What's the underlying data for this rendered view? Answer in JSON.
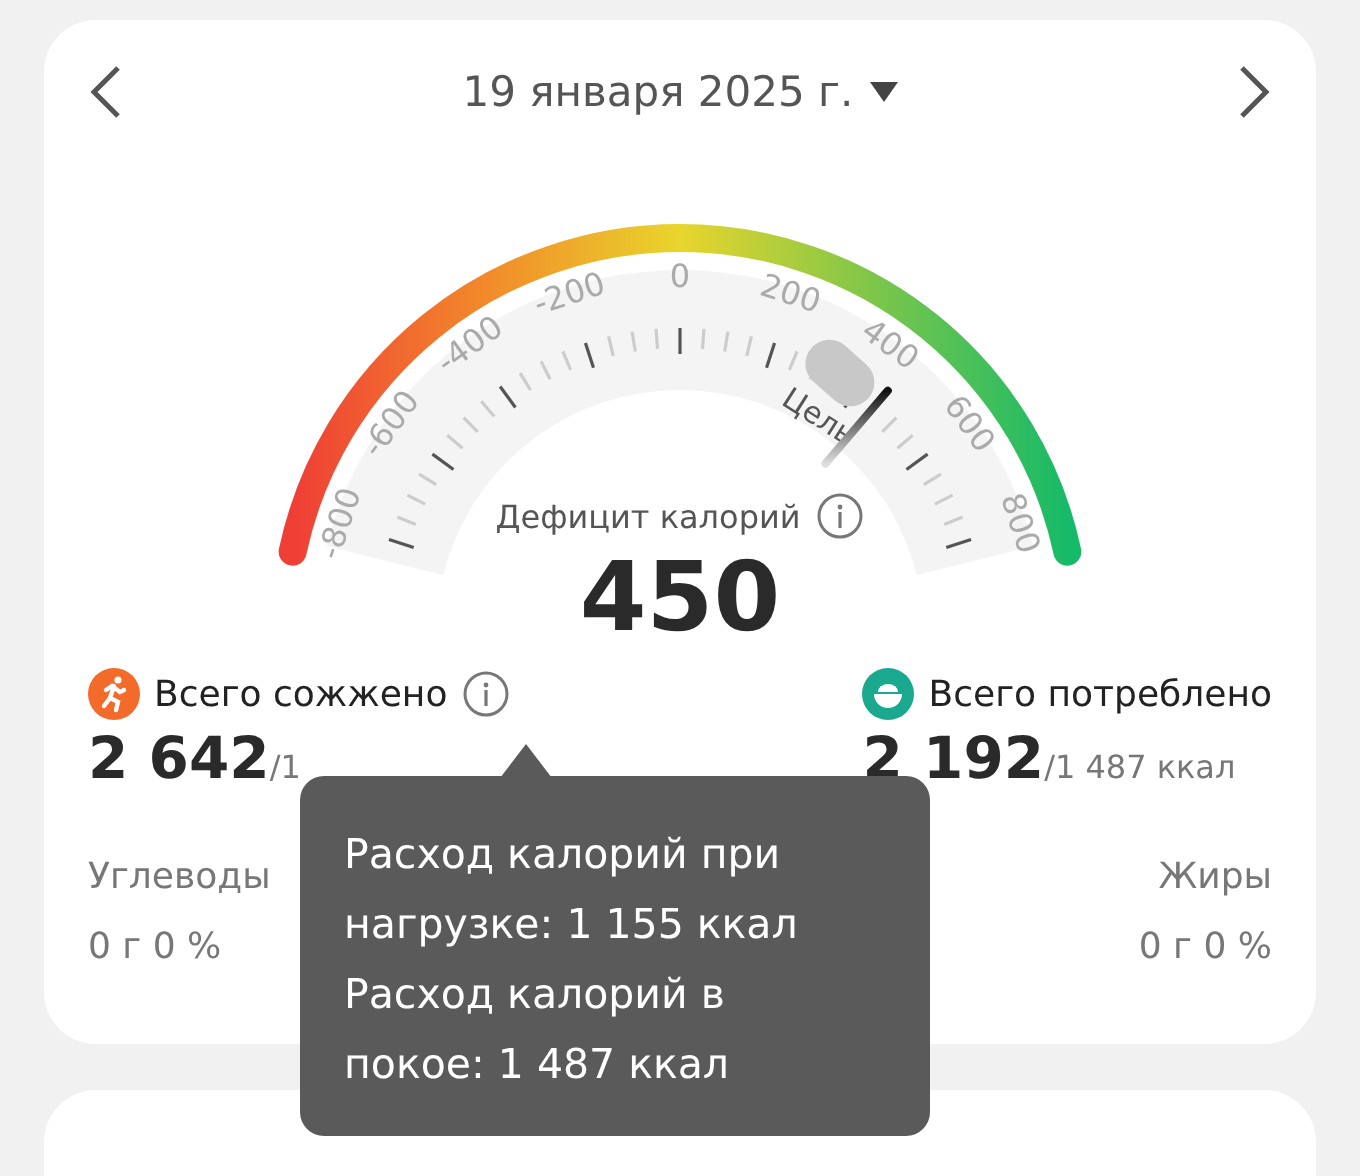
{
  "header": {
    "date": "19 января 2025 г."
  },
  "gauge": {
    "ticks": [
      "-800",
      "-600",
      "-400",
      "-200",
      "0",
      "200",
      "400",
      "600",
      "800"
    ],
    "goal_label": "Цель",
    "title": "Дефицит калорий",
    "value": "450"
  },
  "burned": {
    "label": "Всего сожжено",
    "value": "2 642",
    "target": "/1"
  },
  "consumed": {
    "label": "Всего потреблено",
    "value": "2 192",
    "target": "/1 487 ккал"
  },
  "macros": [
    {
      "name": "Углеводы",
      "amount": "0 г 0 %"
    },
    {
      "name": "Жиры",
      "amount": "0 г 0 %"
    }
  ],
  "tooltip": {
    "lines": [
      "Расход калорий при нагрузке: 1 155 ккал",
      "Расход калорий в покое: 1 487 ккал"
    ]
  }
}
